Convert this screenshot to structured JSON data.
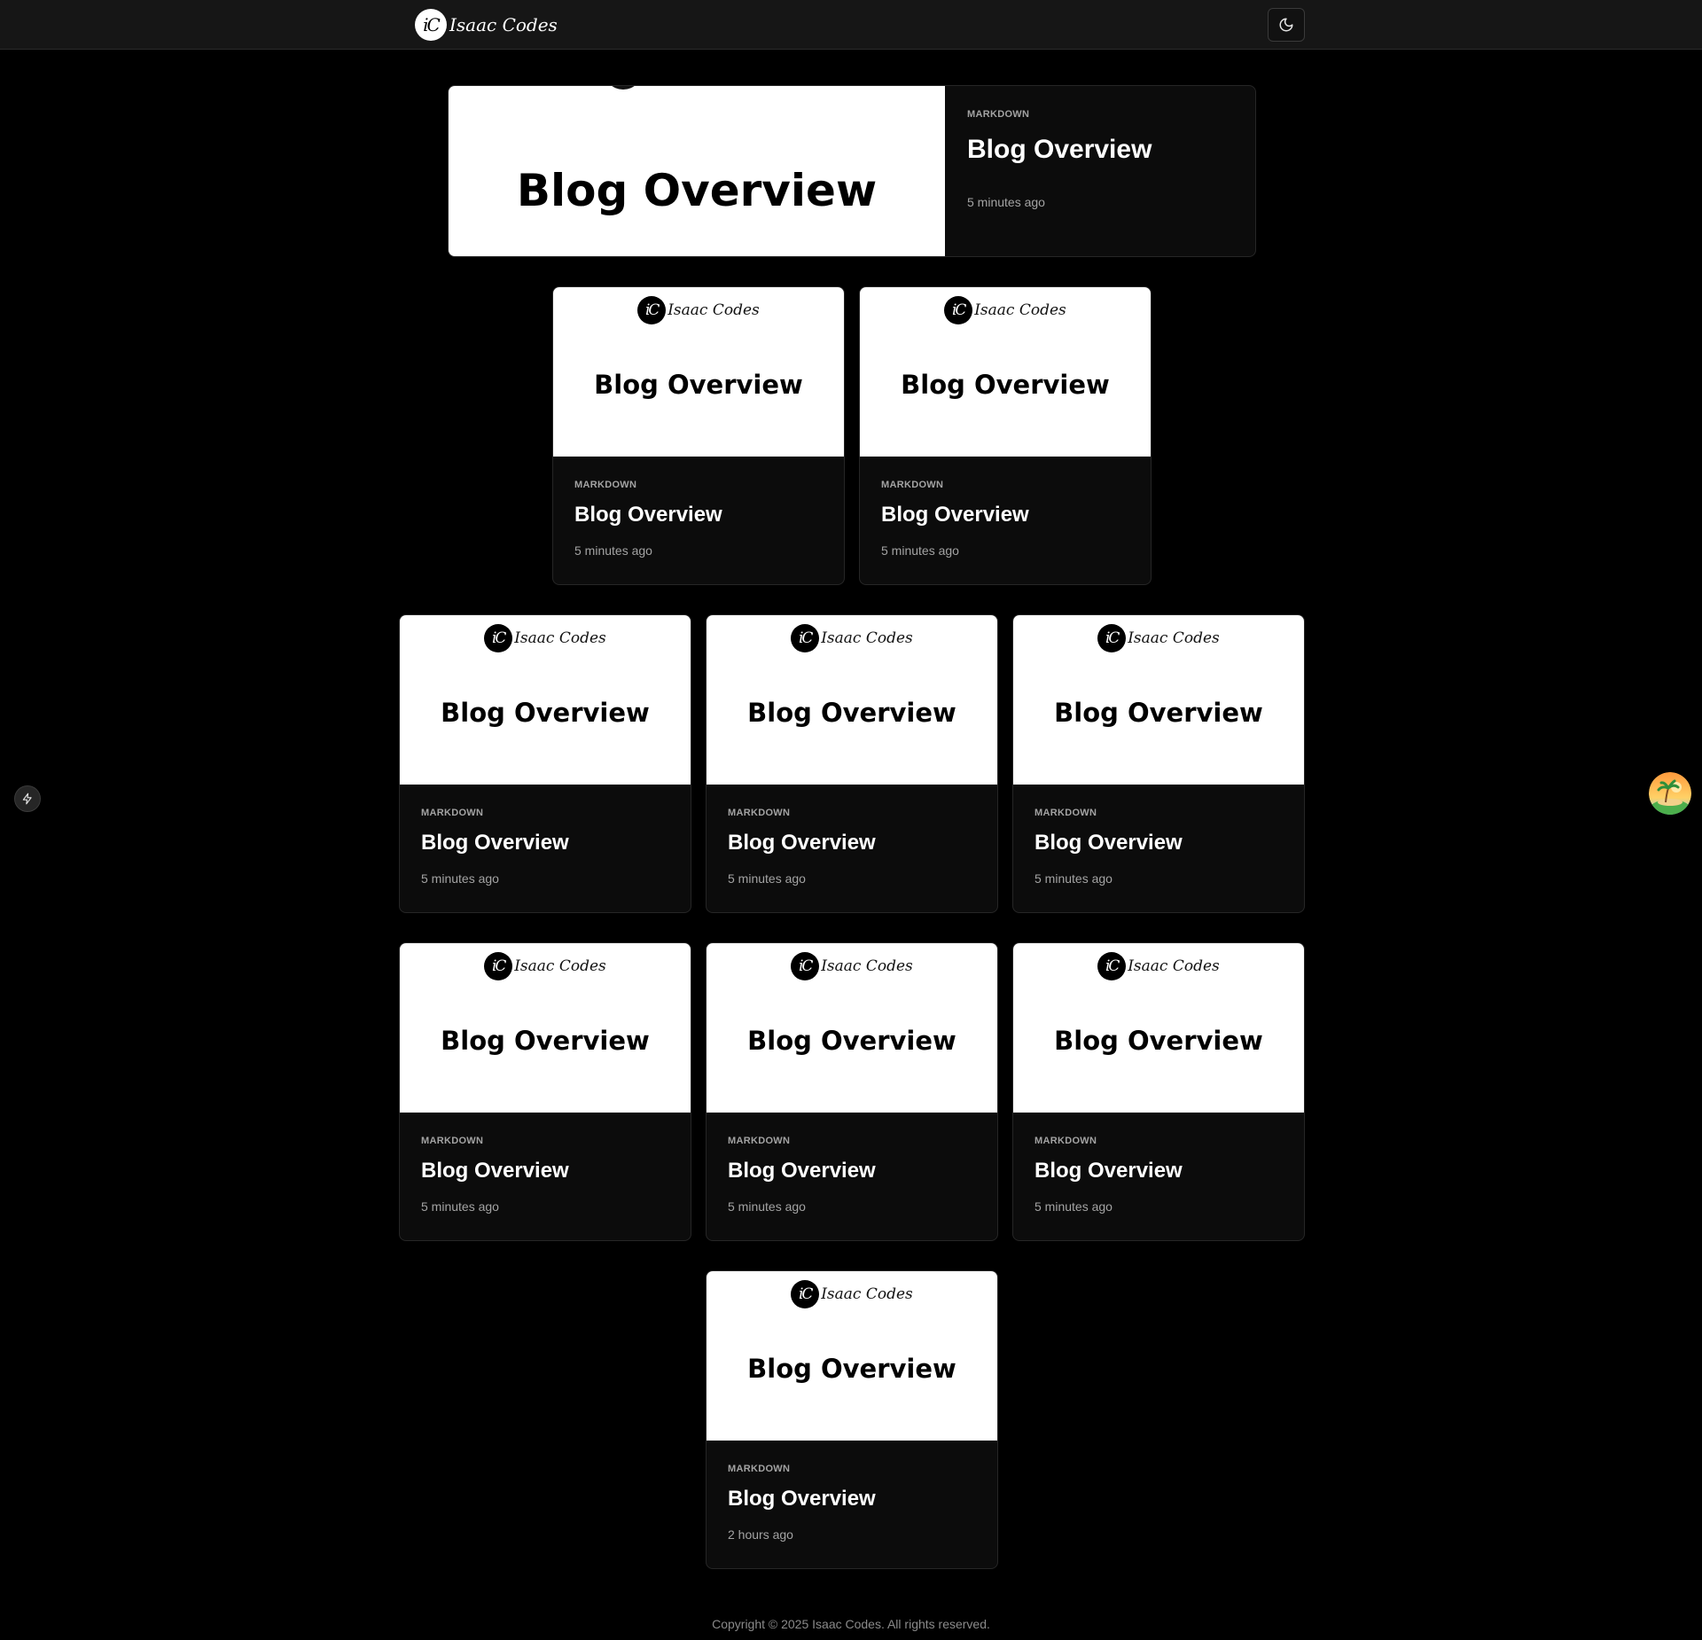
{
  "header": {
    "logo_text": "iC",
    "brand_name": "Isaac Codes",
    "theme_toggle_icon": "moon-icon"
  },
  "featured": {
    "thumbnail_title": "Blog Overview",
    "tag": "MARKDOWN",
    "title": "Blog Overview",
    "time": "5 minutes ago"
  },
  "posts": [
    {
      "logo_text": "iC",
      "brand_name": "Isaac Codes",
      "thumbnail_title": "Blog Overview",
      "tag": "MARKDOWN",
      "title": "Blog Overview",
      "time": "5 minutes ago"
    },
    {
      "logo_text": "iC",
      "brand_name": "Isaac Codes",
      "thumbnail_title": "Blog Overview",
      "tag": "MARKDOWN",
      "title": "Blog Overview",
      "time": "5 minutes ago"
    },
    {
      "logo_text": "iC",
      "brand_name": "Isaac Codes",
      "thumbnail_title": "Blog Overview",
      "tag": "MARKDOWN",
      "title": "Blog Overview",
      "time": "5 minutes ago"
    },
    {
      "logo_text": "iC",
      "brand_name": "Isaac Codes",
      "thumbnail_title": "Blog Overview",
      "tag": "MARKDOWN",
      "title": "Blog Overview",
      "time": "5 minutes ago"
    },
    {
      "logo_text": "iC",
      "brand_name": "Isaac Codes",
      "thumbnail_title": "Blog Overview",
      "tag": "MARKDOWN",
      "title": "Blog Overview",
      "time": "5 minutes ago"
    },
    {
      "logo_text": "iC",
      "brand_name": "Isaac Codes",
      "thumbnail_title": "Blog Overview",
      "tag": "MARKDOWN",
      "title": "Blog Overview",
      "time": "5 minutes ago"
    },
    {
      "logo_text": "iC",
      "brand_name": "Isaac Codes",
      "thumbnail_title": "Blog Overview",
      "tag": "MARKDOWN",
      "title": "Blog Overview",
      "time": "5 minutes ago"
    },
    {
      "logo_text": "iC",
      "brand_name": "Isaac Codes",
      "thumbnail_title": "Blog Overview",
      "tag": "MARKDOWN",
      "title": "Blog Overview",
      "time": "5 minutes ago"
    },
    {
      "logo_text": "iC",
      "brand_name": "Isaac Codes",
      "thumbnail_title": "Blog Overview",
      "tag": "MARKDOWN",
      "title": "Blog Overview",
      "time": "2 hours ago"
    }
  ],
  "widgets": {
    "left_icon": "lightning-icon",
    "right_icon": "island-avatar-icon"
  },
  "footer": {
    "copyright": "Copyright © 2025 Isaac Codes. All rights reserved."
  },
  "colors": {
    "background": "#000000",
    "header_bg": "#161616",
    "card_bg": "#0c0c0c",
    "thumbnail_bg": "#ffffff",
    "muted_text": "#a3a3a3"
  }
}
